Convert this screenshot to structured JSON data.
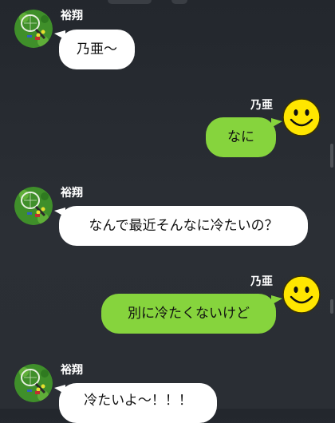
{
  "colors": {
    "background": "#262a30",
    "incoming_bubble": "#ffffff",
    "outgoing_bubble": "#86d43d",
    "name_text": "#ffffff",
    "message_text": "#111111",
    "smiley_yellow": "#ffe600"
  },
  "chat": {
    "messages": [
      {
        "sender": "裕翔",
        "side": "left",
        "avatar_icon": "tennis-racket-avatar-icon",
        "text": "乃亜〜"
      },
      {
        "sender": "乃亜",
        "side": "right",
        "avatar_icon": "smiley-face-avatar-icon",
        "text": "なに"
      },
      {
        "sender": "裕翔",
        "side": "left",
        "avatar_icon": "tennis-racket-avatar-icon",
        "text": "なんで最近そんなに冷たいの？"
      },
      {
        "sender": "乃亜",
        "side": "right",
        "avatar_icon": "smiley-face-avatar-icon",
        "text": "別に冷たくないけど"
      },
      {
        "sender": "裕翔",
        "side": "left",
        "avatar_icon": "tennis-racket-avatar-icon",
        "text": "冷たいよ〜！！！"
      }
    ]
  }
}
